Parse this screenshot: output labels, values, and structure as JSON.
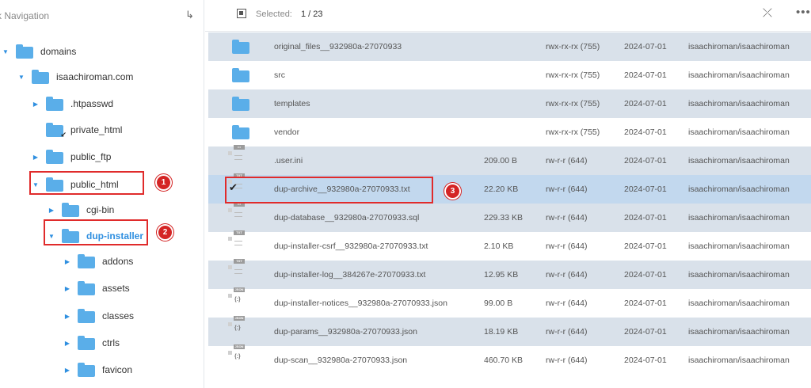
{
  "left_panel": {
    "title": "k Navigation",
    "tree": [
      {
        "label": "domains",
        "arrow": "▼"
      },
      {
        "label": "isaachiroman.com",
        "arrow": "▼"
      },
      {
        "label": ".htpasswd",
        "arrow": "▶"
      },
      {
        "label": "private_html",
        "arrow": ""
      },
      {
        "label": "public_ftp",
        "arrow": "▶"
      },
      {
        "label": "public_html",
        "arrow": "▼"
      },
      {
        "label": "cgi-bin",
        "arrow": "▶"
      },
      {
        "label": "dup-installer",
        "arrow": "▼"
      },
      {
        "label": "addons",
        "arrow": "▶"
      },
      {
        "label": "assets",
        "arrow": "▶"
      },
      {
        "label": "classes",
        "arrow": "▶"
      },
      {
        "label": "ctrls",
        "arrow": "▶"
      },
      {
        "label": "favicon",
        "arrow": "▶"
      }
    ]
  },
  "toolbar": {
    "selected_label": "Selected:",
    "selected_count": "1 / 23"
  },
  "file_list": [
    {
      "name": "original_files__932980a-27070933",
      "size": "",
      "perm": "rwx-rx-rx (755)",
      "date": "2024-07-01",
      "owner": "isaachiroman/isaachiroman",
      "type": "folder"
    },
    {
      "name": "src",
      "size": "",
      "perm": "rwx-rx-rx (755)",
      "date": "2024-07-01",
      "owner": "isaachiroman/isaachiroman",
      "type": "folder"
    },
    {
      "name": "templates",
      "size": "",
      "perm": "rwx-rx-rx (755)",
      "date": "2024-07-01",
      "owner": "isaachiroman/isaachiroman",
      "type": "folder"
    },
    {
      "name": "vendor",
      "size": "",
      "perm": "rwx-rx-rx (755)",
      "date": "2024-07-01",
      "owner": "isaachiroman/isaachiroman",
      "type": "folder"
    },
    {
      "name": ".user.ini",
      "size": "209.00 B",
      "perm": "rw-r-r (644)",
      "date": "2024-07-01",
      "owner": "isaachiroman/isaachiroman",
      "type": "file"
    },
    {
      "name": "dup-archive__932980a-27070933.txt",
      "size": "22.20 KB",
      "perm": "rw-r-r (644)",
      "date": "2024-07-01",
      "owner": "isaachiroman/isaachiroman",
      "type": "txt"
    },
    {
      "name": "dup-database__932980a-27070933.sql",
      "size": "229.33 KB",
      "perm": "rw-r-r (644)",
      "date": "2024-07-01",
      "owner": "isaachiroman/isaachiroman",
      "type": "file"
    },
    {
      "name": "dup-installer-csrf__932980a-27070933.txt",
      "size": "2.10 KB",
      "perm": "rw-r-r (644)",
      "date": "2024-07-01",
      "owner": "isaachiroman/isaachiroman",
      "type": "txt"
    },
    {
      "name": "dup-installer-log__384267e-27070933.txt",
      "size": "12.95 KB",
      "perm": "rw-r-r (644)",
      "date": "2024-07-01",
      "owner": "isaachiroman/isaachiroman",
      "type": "txt"
    },
    {
      "name": "dup-installer-notices__932980a-27070933.json",
      "size": "99.00 B",
      "perm": "rw-r-r (644)",
      "date": "2024-07-01",
      "owner": "isaachiroman/isaachiroman",
      "type": "json"
    },
    {
      "name": "dup-params__932980a-27070933.json",
      "size": "18.19 KB",
      "perm": "rw-r-r (644)",
      "date": "2024-07-01",
      "owner": "isaachiroman/isaachiroman",
      "type": "json"
    },
    {
      "name": "dup-scan__932980a-27070933.json",
      "size": "460.70 KB",
      "perm": "rw-r-r (644)",
      "date": "2024-07-01",
      "owner": "isaachiroman/isaachiroman",
      "type": "json"
    }
  ],
  "file_icon_tags": {
    "txt": "TXT",
    "json": "JSON",
    "file": "•••"
  },
  "annotations": [
    {
      "number": "1"
    },
    {
      "number": "2"
    },
    {
      "number": "3"
    }
  ],
  "colors": {
    "accent": "#2f8fe0",
    "folder": "#5aaee9",
    "annotation": "#e02b2b",
    "selected_row": "#c2d8ee",
    "alt_row": "#d9e1ea"
  }
}
